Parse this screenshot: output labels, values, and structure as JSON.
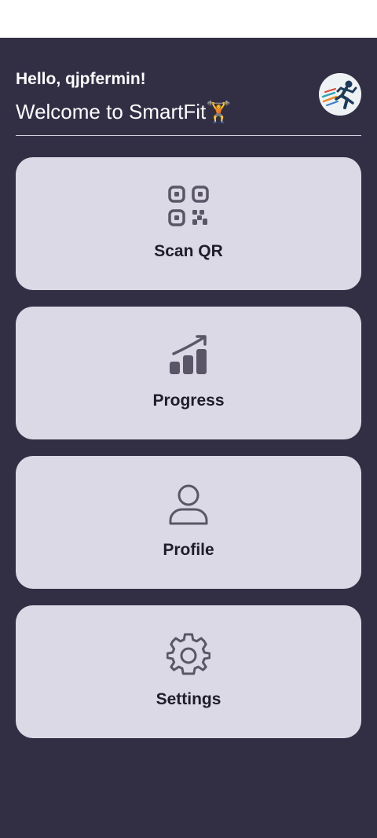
{
  "header": {
    "greeting": "Hello, qjpfermin!",
    "welcome": "Welcome to SmartFit🏋️",
    "avatar_icon": "runner-avatar-icon"
  },
  "menu": {
    "items": [
      {
        "label": "Scan QR",
        "icon": "qr-code-icon"
      },
      {
        "label": "Progress",
        "icon": "bar-chart-trend-icon"
      },
      {
        "label": "Profile",
        "icon": "user-icon"
      },
      {
        "label": "Settings",
        "icon": "gear-icon"
      }
    ]
  },
  "colors": {
    "background": "#322f45",
    "card": "#dbd9e5",
    "icon": "#5a5668",
    "text_light": "#ffffff",
    "text_dark": "#1f1d2b"
  }
}
